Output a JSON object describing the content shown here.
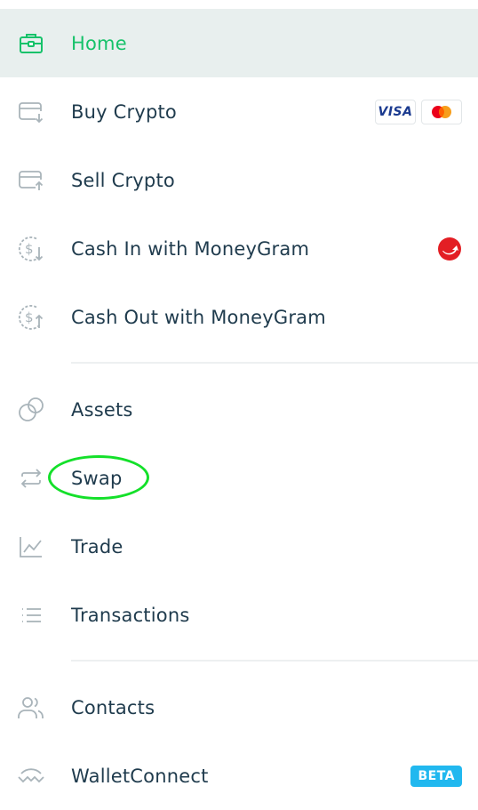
{
  "menu": {
    "home": "Home",
    "buy_crypto": "Buy Crypto",
    "sell_crypto": "Sell Crypto",
    "cash_in": "Cash In with MoneyGram",
    "cash_out": "Cash Out with MoneyGram",
    "assets": "Assets",
    "swap": "Swap",
    "trade": "Trade",
    "transactions": "Transactions",
    "contacts": "Contacts",
    "walletconnect": "WalletConnect"
  },
  "badges": {
    "visa": "VISA",
    "beta": "BETA"
  },
  "colors": {
    "active_green": "#16c26a",
    "active_bg": "#e8efee",
    "text": "#1f3b4d",
    "icon_gray": "#a9b4ba",
    "beta_blue": "#21b8ef",
    "moneygram_red": "#e31e24",
    "highlight_green": "#14e02a"
  }
}
